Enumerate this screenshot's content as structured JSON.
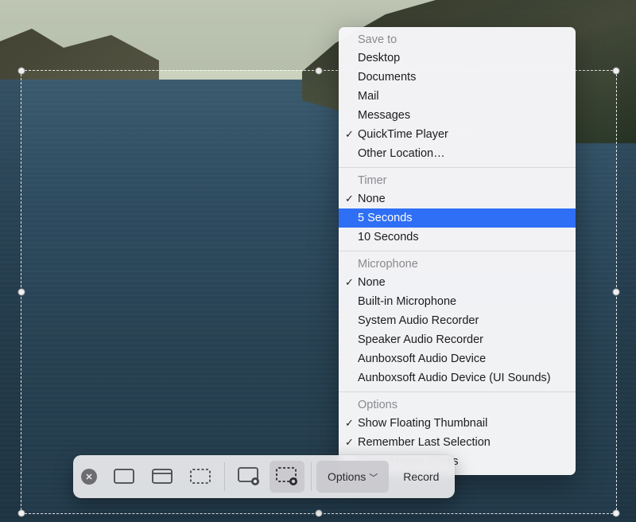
{
  "menu": {
    "sections": [
      {
        "header": "Save to",
        "items": [
          {
            "label": "Desktop",
            "checked": false
          },
          {
            "label": "Documents",
            "checked": false
          },
          {
            "label": "Mail",
            "checked": false
          },
          {
            "label": "Messages",
            "checked": false
          },
          {
            "label": "QuickTime Player",
            "checked": true
          },
          {
            "label": "Other Location…",
            "checked": false
          }
        ]
      },
      {
        "header": "Timer",
        "items": [
          {
            "label": "None",
            "checked": true
          },
          {
            "label": "5 Seconds",
            "checked": false,
            "highlight": true
          },
          {
            "label": "10 Seconds",
            "checked": false
          }
        ]
      },
      {
        "header": "Microphone",
        "items": [
          {
            "label": "None",
            "checked": true
          },
          {
            "label": "Built-in Microphone",
            "checked": false
          },
          {
            "label": "System Audio Recorder",
            "checked": false
          },
          {
            "label": "Speaker Audio Recorder",
            "checked": false
          },
          {
            "label": "Aunboxsoft Audio Device",
            "checked": false
          },
          {
            "label": "Aunboxsoft Audio Device (UI Sounds)",
            "checked": false
          }
        ]
      },
      {
        "header": "Options",
        "items": [
          {
            "label": "Show Floating Thumbnail",
            "checked": true
          },
          {
            "label": "Remember Last Selection",
            "checked": true
          },
          {
            "label": "Show Mouse Clicks",
            "checked": false
          }
        ]
      }
    ]
  },
  "toolbar": {
    "options_label": "Options",
    "record_label": "Record"
  }
}
